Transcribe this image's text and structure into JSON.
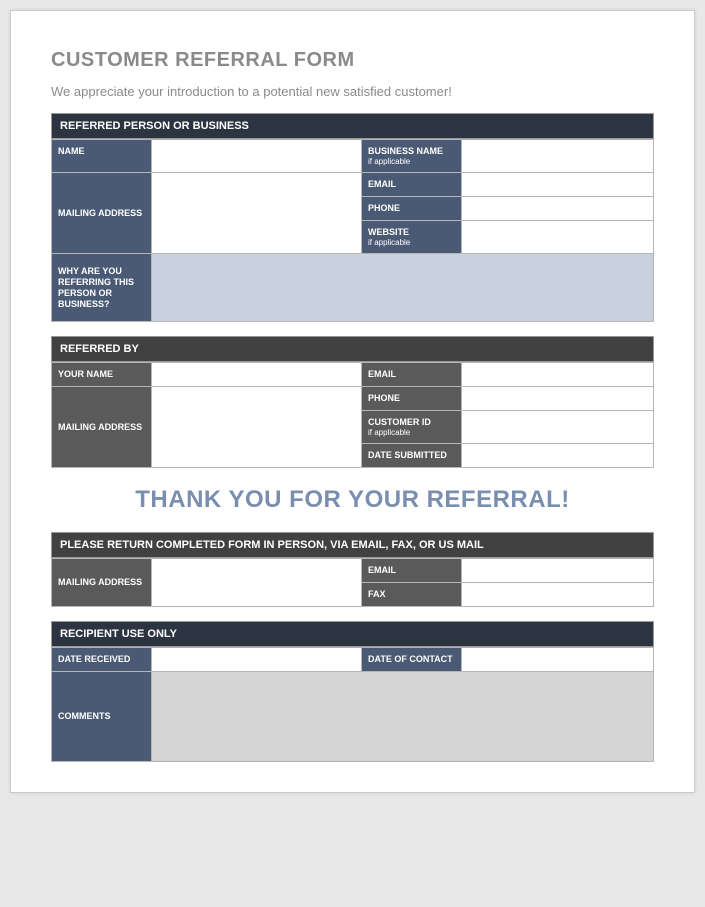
{
  "title": "CUSTOMER REFERRAL FORM",
  "subtitle": "We appreciate your introduction to a potential new satisfied customer!",
  "section1": {
    "header": "REFERRED PERSON OR BUSINESS",
    "name": "NAME",
    "business_name": "BUSINESS NAME",
    "business_sub": "if applicable",
    "mailing_address": "MAILING ADDRESS",
    "email": "EMAIL",
    "phone": "PHONE",
    "website": "WEBSITE",
    "website_sub": "if applicable",
    "why": "WHY ARE YOU REFERRING THIS PERSON OR BUSINESS?"
  },
  "section2": {
    "header": "REFERRED BY",
    "your_name": "YOUR NAME",
    "email": "EMAIL",
    "mailing_address": "MAILING ADDRESS",
    "phone": "PHONE",
    "customer_id": "CUSTOMER ID",
    "customer_sub": "if applicable",
    "date_submitted": "DATE SUBMITTED"
  },
  "thankyou": "THANK YOU FOR YOUR REFERRAL!",
  "section3": {
    "header": "PLEASE RETURN COMPLETED FORM IN PERSON, VIA EMAIL, FAX, OR US MAIL",
    "mailing_address": "MAILING ADDRESS",
    "email": "EMAIL",
    "fax": "FAX"
  },
  "section4": {
    "header": "RECIPIENT USE ONLY",
    "date_received": "DATE RECEIVED",
    "date_contact": "DATE OF CONTACT",
    "comments": "COMMENTS"
  }
}
